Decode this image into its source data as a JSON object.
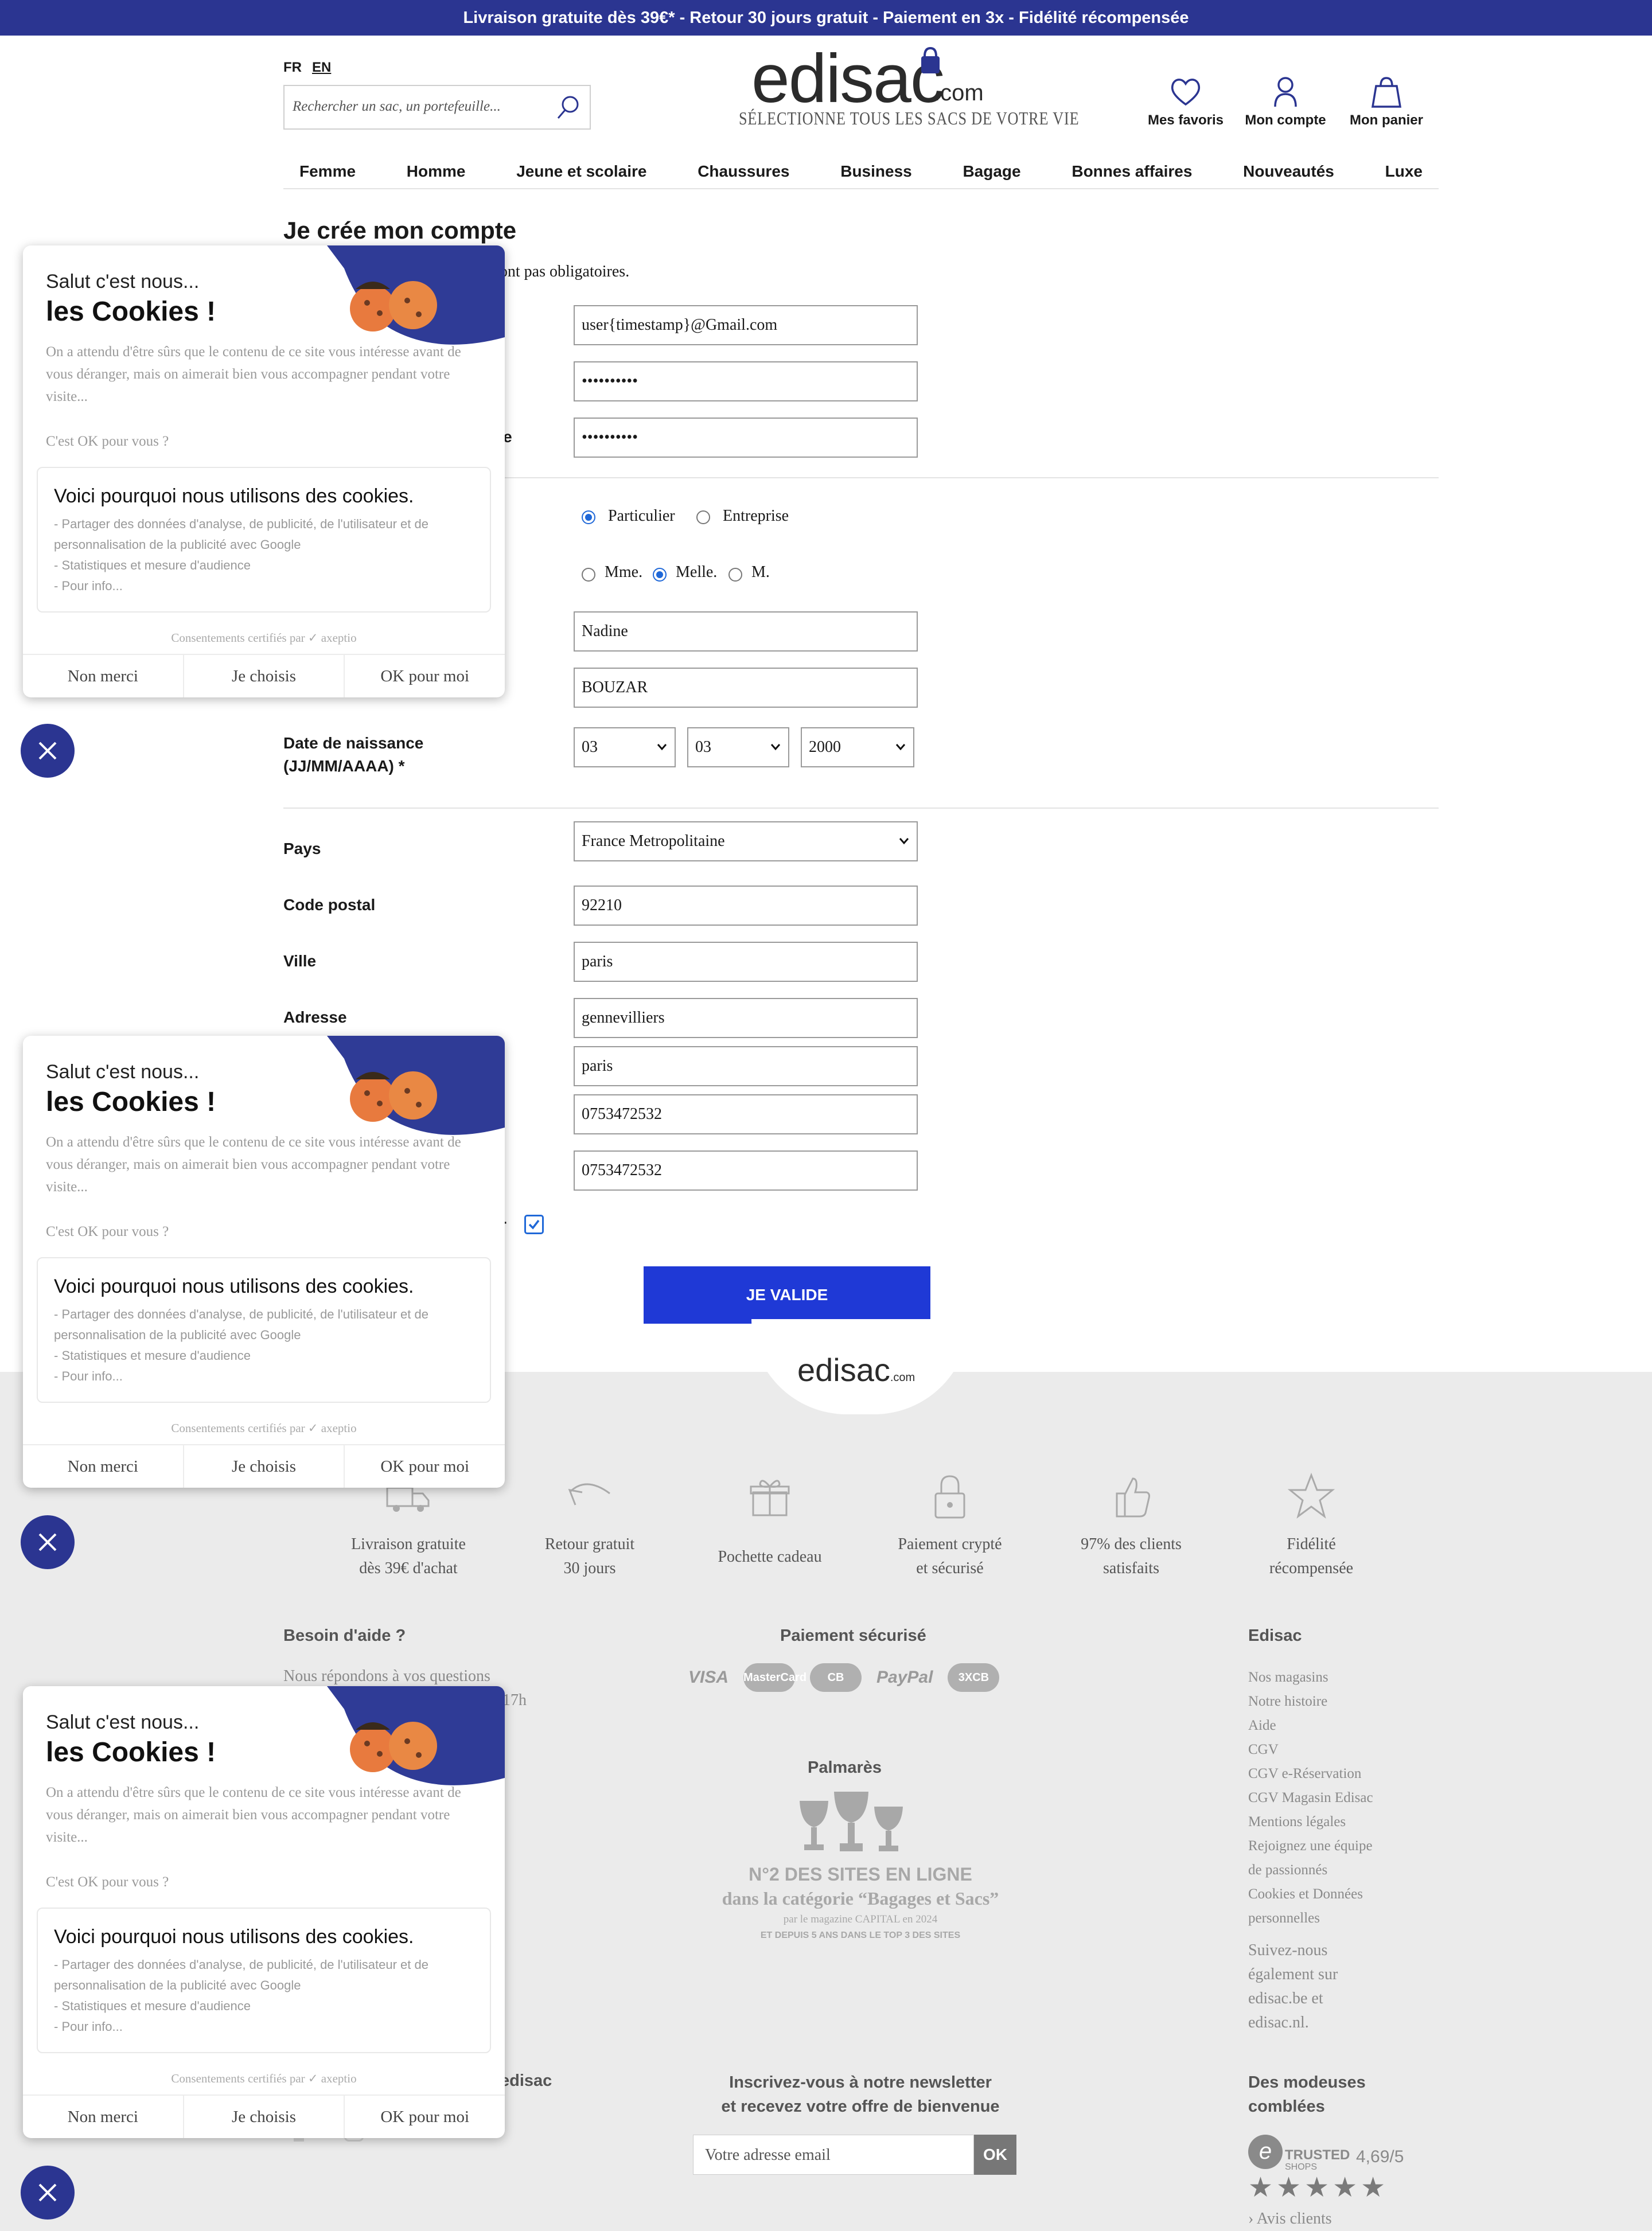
{
  "top_banner": "Livraison gratuite dès 39€* - Retour 30 jours gratuit - Paiement en 3x - Fidélité récompensée",
  "header": {
    "lang_fr": "FR",
    "lang_en": "EN",
    "search_placeholder": "Rechercher un sac, un portefeuille...",
    "logo_text": "edisac",
    "logo_com": ".com",
    "logo_tagline": "SÉLECTIONNE TOUS LES SACS DE VOTRE VIE",
    "favorites": "Mes favoris",
    "account": "Mon compte",
    "cart": "Mon panier"
  },
  "nav": [
    "Femme",
    "Homme",
    "Jeune et scolaire",
    "Chaussures",
    "Business",
    "Bagage",
    "Bonnes affaires",
    "Nouveautés",
    "Luxe"
  ],
  "form": {
    "title": "Je crée mon compte",
    "required_note": "sont pas obligatoires.",
    "email": "user{timestamp}@Gmail.com",
    "password": "••••••••••",
    "password_confirm": "••••••••••",
    "password_confirm_label_tail": "sse",
    "type_particulier": "Particulier",
    "type_entreprise": "Entreprise",
    "civ_mme": "Mme.",
    "civ_melle": "Melle.",
    "civ_m": "M.",
    "first_name": "Nadine",
    "last_name": "BOUZAR",
    "dob_label": "Date de naissance\n(JJ/MM/AAAA) *",
    "dob_day": "03",
    "dob_month": "03",
    "dob_year": "2000",
    "country_label": "Pays",
    "country": "France Metropolitaine",
    "postal_label": "Code postal",
    "postal": "92210",
    "city_label": "Ville",
    "city": "paris",
    "address_label": "Adresse",
    "address": "gennevilliers",
    "address2": "paris",
    "phone1": "0753472532",
    "phone2": "0753472532",
    "newsletter_label_tail": "r",
    "submit": "JE VALIDE"
  },
  "footer": {
    "logo": "edisac",
    "logo_com": ".com",
    "features": [
      {
        "icon": "truck-icon",
        "text": "Livraison gratuite\ndès 39€ d'achat"
      },
      {
        "icon": "return-arrow-icon",
        "text": "Retour gratuit\n30 jours"
      },
      {
        "icon": "gift-icon",
        "text": "Pochette cadeau"
      },
      {
        "icon": "lock-icon",
        "text": "Paiement crypté\net sécurisé"
      },
      {
        "icon": "thumbs-up-icon",
        "text": "97% des clients\nsatisfaits"
      },
      {
        "icon": "star-icon",
        "text": "Fidélité\nrécompensée"
      }
    ],
    "help_title": "Besoin d'aide ?",
    "help_text": "Nous répondons à vos questions",
    "help_hours_tail": "17h",
    "payment_title": "Paiement sécurisé",
    "payment_methods": [
      "VISA",
      "MasterCard",
      "CB",
      "PayPal",
      "3XCB"
    ],
    "palmares_title": "Palmarès",
    "palmares_line1": "N°2 DES SITES EN LIGNE",
    "palmares_line2": "dans la catégorie “Bagages et Sacs”",
    "palmares_line3": "par le magazine CAPITAL en 2024",
    "palmares_line4": "ET DEPUIS 5 ANS DANS LE TOP 3 DES SITES",
    "edisac_title": "Edisac",
    "edisac_links": [
      "Nos magasins",
      "Notre histoire",
      "Aide",
      "CGV",
      "CGV e-Réservation",
      "CGV Magasin Edisac",
      "Mentions légales",
      "Rejoignez une équipe",
      "de passionnés",
      "Cookies et Données",
      "personnelles"
    ],
    "follow_text": "Suivez-nous\négalement sur\nedisac.be et\nedisac.nl.",
    "social_tail": "edisac",
    "newsletter_title": "Inscrivez-vous à notre newsletter\net recevez votre offre de bienvenue",
    "newsletter_placeholder": "Votre adresse email",
    "newsletter_ok": "OK",
    "reviews_title": "Des modeuses\ncomblées",
    "trusted": "TRUSTED",
    "trusted_shops": "SHOPS",
    "rating": "4,69/5",
    "reviews_link": "Avis clients"
  },
  "cookie": {
    "hi": "Salut c'est nous...",
    "title": "les Cookies !",
    "body": "On a attendu d'être sûrs que le contenu de ce site vous intéresse avant de vous déranger, mais on aimerait bien vous accompagner pendant votre visite...",
    "ok_question": "C'est OK pour vous ?",
    "why_title": "Voici pourquoi nous utilisons des cookies.",
    "why_items": [
      "Partager des données d'analyse, de publicité, de l'utilisateur et de personnalisation de la publicité avec Google",
      "Statistiques et mesure d'audience",
      "Pour info..."
    ],
    "certified": "Consentements certifiés par ✓ axeptio",
    "btn_no": "Non merci",
    "btn_choose": "Je choisis",
    "btn_ok": "OK pour moi"
  },
  "colors": {
    "brand_navy": "#2b3591",
    "button_blue": "#1f39d6",
    "radio_blue": "#1f68d8"
  }
}
